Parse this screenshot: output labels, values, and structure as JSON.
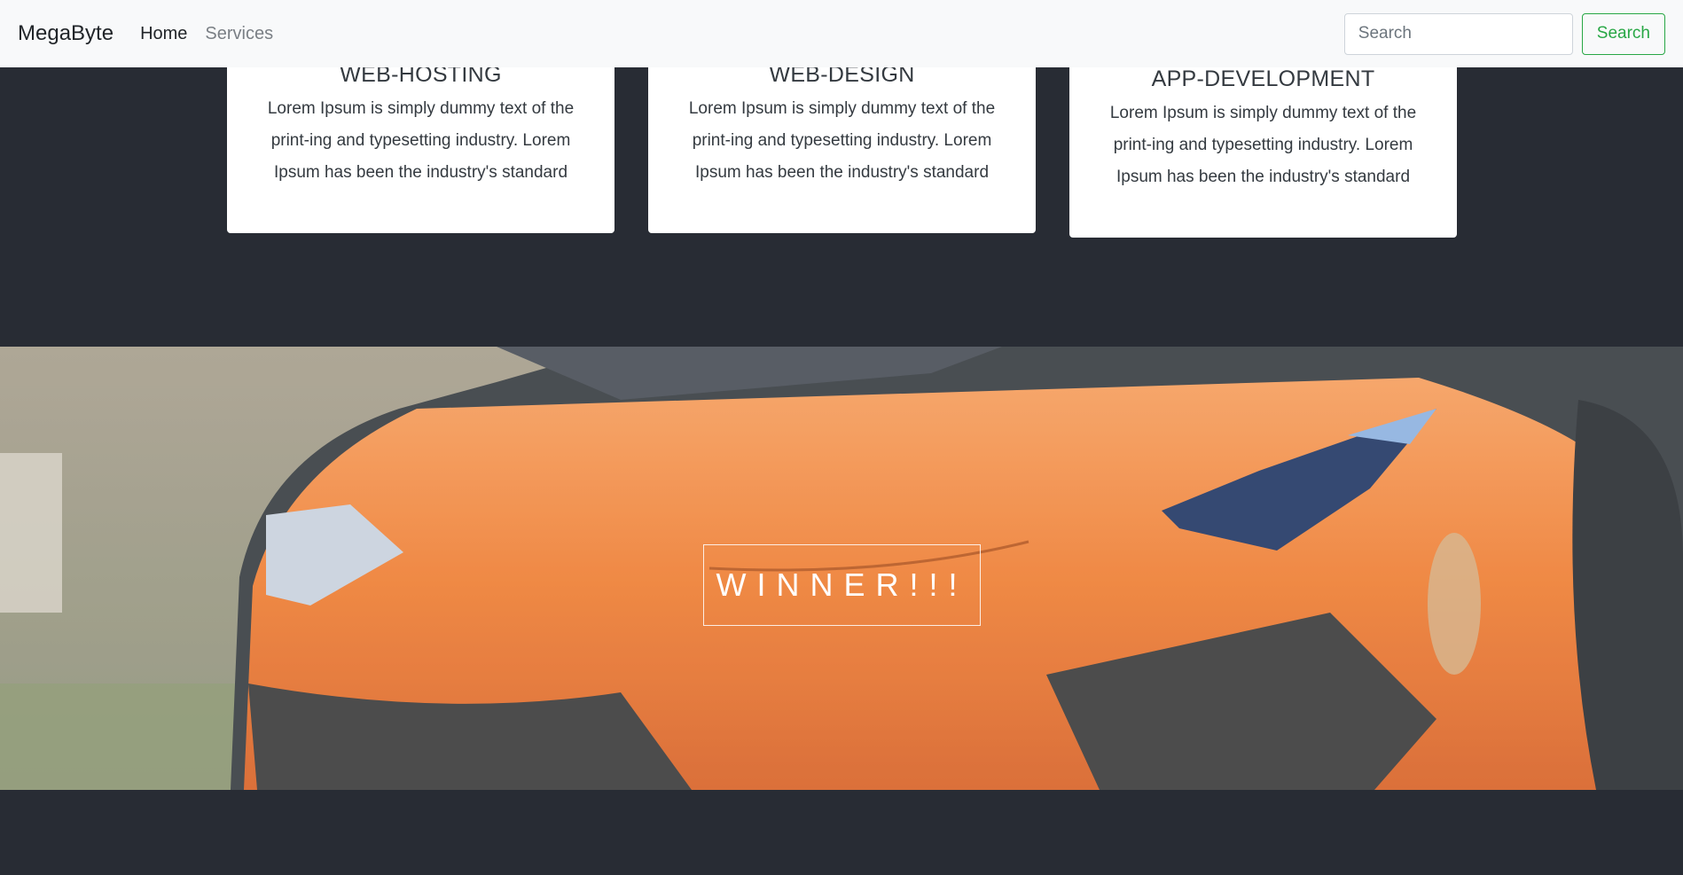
{
  "navbar": {
    "brand": "MegaByte",
    "links": [
      {
        "label": "Home",
        "active": true
      },
      {
        "label": "Services",
        "active": false
      }
    ],
    "search": {
      "placeholder": "Search",
      "button_label": "Search"
    }
  },
  "cards": [
    {
      "title": "WEB-HOSTING",
      "text": "Lorem Ipsum is simply dummy text of the print-ing and typesetting industry. Lorem Ipsum has been the industry's standard"
    },
    {
      "title": "WEB-DESIGN",
      "text": "Lorem Ipsum is simply dummy text of the print-ing and typesetting industry. Lorem Ipsum has been the industry's standard"
    },
    {
      "title": "APP-DEVELOPMENT",
      "text": "Lorem Ipsum is simply dummy text of the print-ing and typesetting industry. Lorem Ipsum has been the industry's standard"
    }
  ],
  "hero": {
    "caption": "WINNER!!!",
    "image": "orange-sports-car-photo"
  },
  "colors": {
    "navbar_bg": "#f8f9fa",
    "page_bg": "#282c34",
    "search_button": "#28a745",
    "car_orange": "#f07a2a"
  }
}
